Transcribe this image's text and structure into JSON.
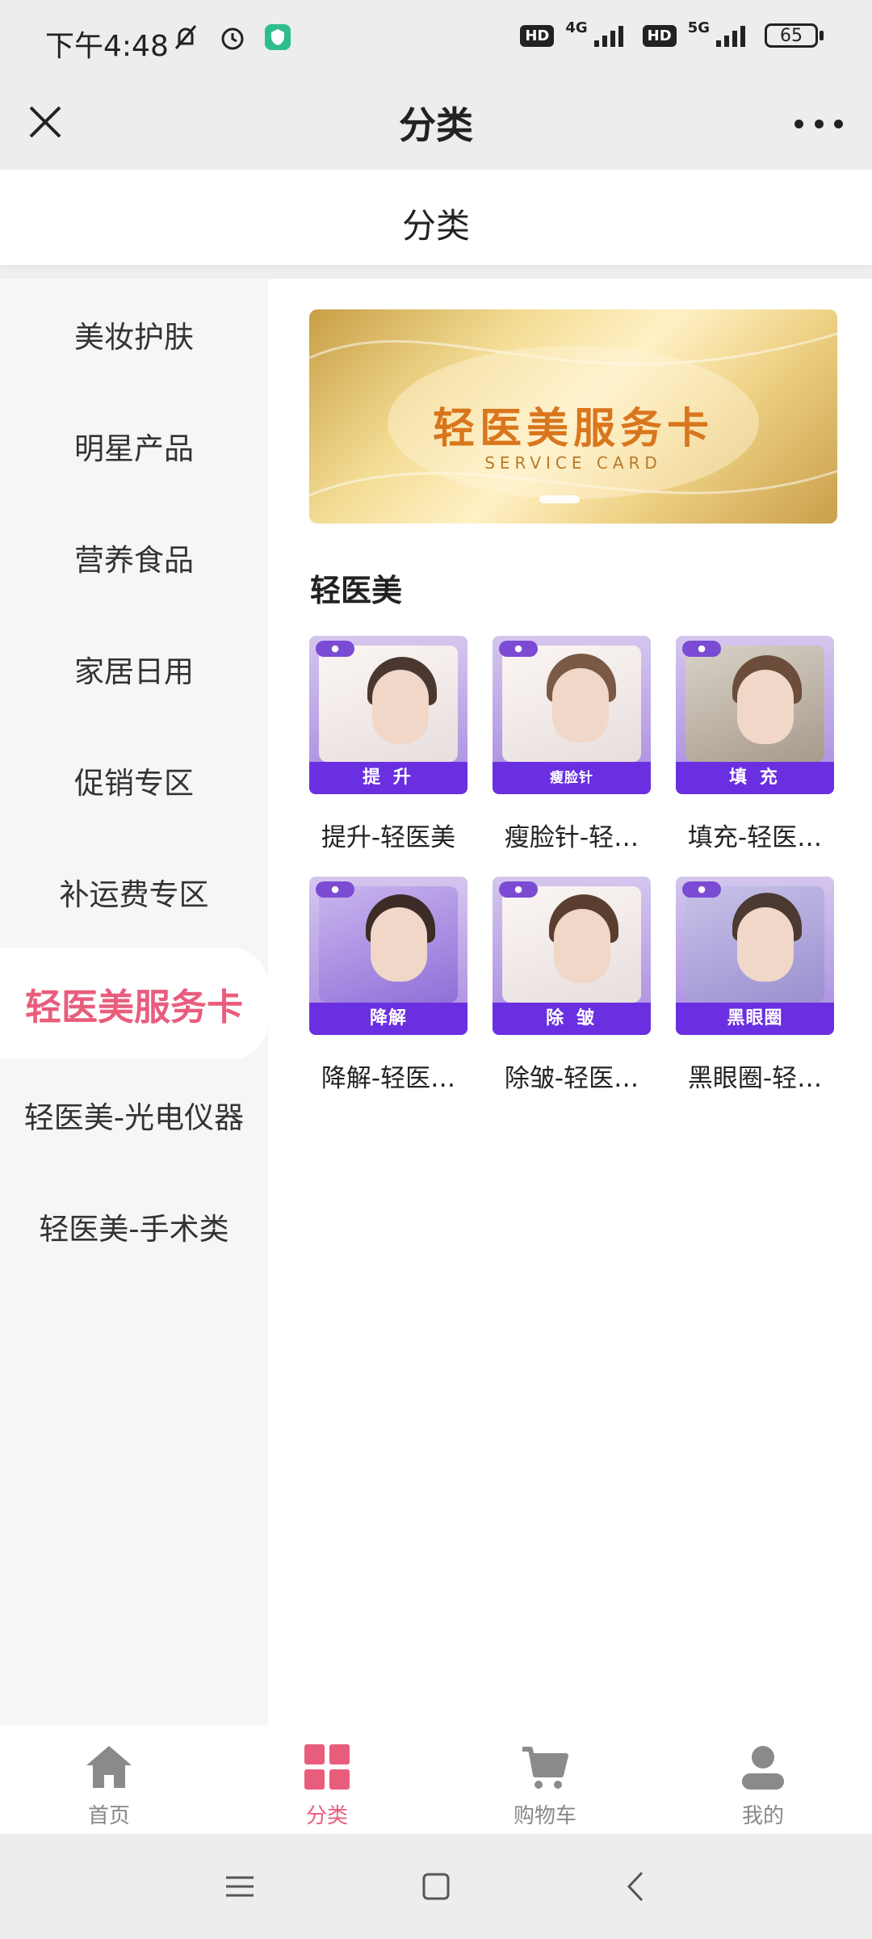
{
  "status": {
    "time": "下午4:48",
    "net1": "4G",
    "net2": "5G",
    "hd": "HD",
    "battery": "65"
  },
  "titlebar": {
    "title": "分类"
  },
  "subheader": {
    "title": "分类"
  },
  "sidebar": {
    "items": [
      {
        "label": "美妆护肤"
      },
      {
        "label": "明星产品"
      },
      {
        "label": "营养食品"
      },
      {
        "label": "家居日用"
      },
      {
        "label": "促销专区"
      },
      {
        "label": "补运费专区"
      },
      {
        "label": "轻医美服务卡"
      },
      {
        "label": "轻医美-光电仪器"
      },
      {
        "label": "轻医美-手术类"
      }
    ],
    "active_index": 6
  },
  "banner": {
    "title": "轻医美服务卡",
    "subtitle": "SERVICE CARD"
  },
  "section": {
    "title": "轻医美"
  },
  "products": [
    {
      "tag": "提 升",
      "name": "提升-轻医美"
    },
    {
      "tag": "瘦脸针",
      "name": "瘦脸针-轻…"
    },
    {
      "tag": "填 充",
      "name": "填充-轻医…"
    },
    {
      "tag": "降解",
      "name": "降解-轻医…"
    },
    {
      "tag": "除 皱",
      "name": "除皱-轻医…"
    },
    {
      "tag": "黑眼圈",
      "name": "黑眼圈-轻…"
    }
  ],
  "tabbar": {
    "tabs": [
      {
        "label": "首页",
        "icon": "home-icon"
      },
      {
        "label": "分类",
        "icon": "category-grid-icon"
      },
      {
        "label": "购物车",
        "icon": "cart-icon"
      },
      {
        "label": "我的",
        "icon": "user-icon"
      }
    ],
    "active_index": 1
  },
  "colors": {
    "accent": "#e95d7c",
    "tag_purple": "#6a2fe0",
    "inactive_gray": "#888888"
  }
}
